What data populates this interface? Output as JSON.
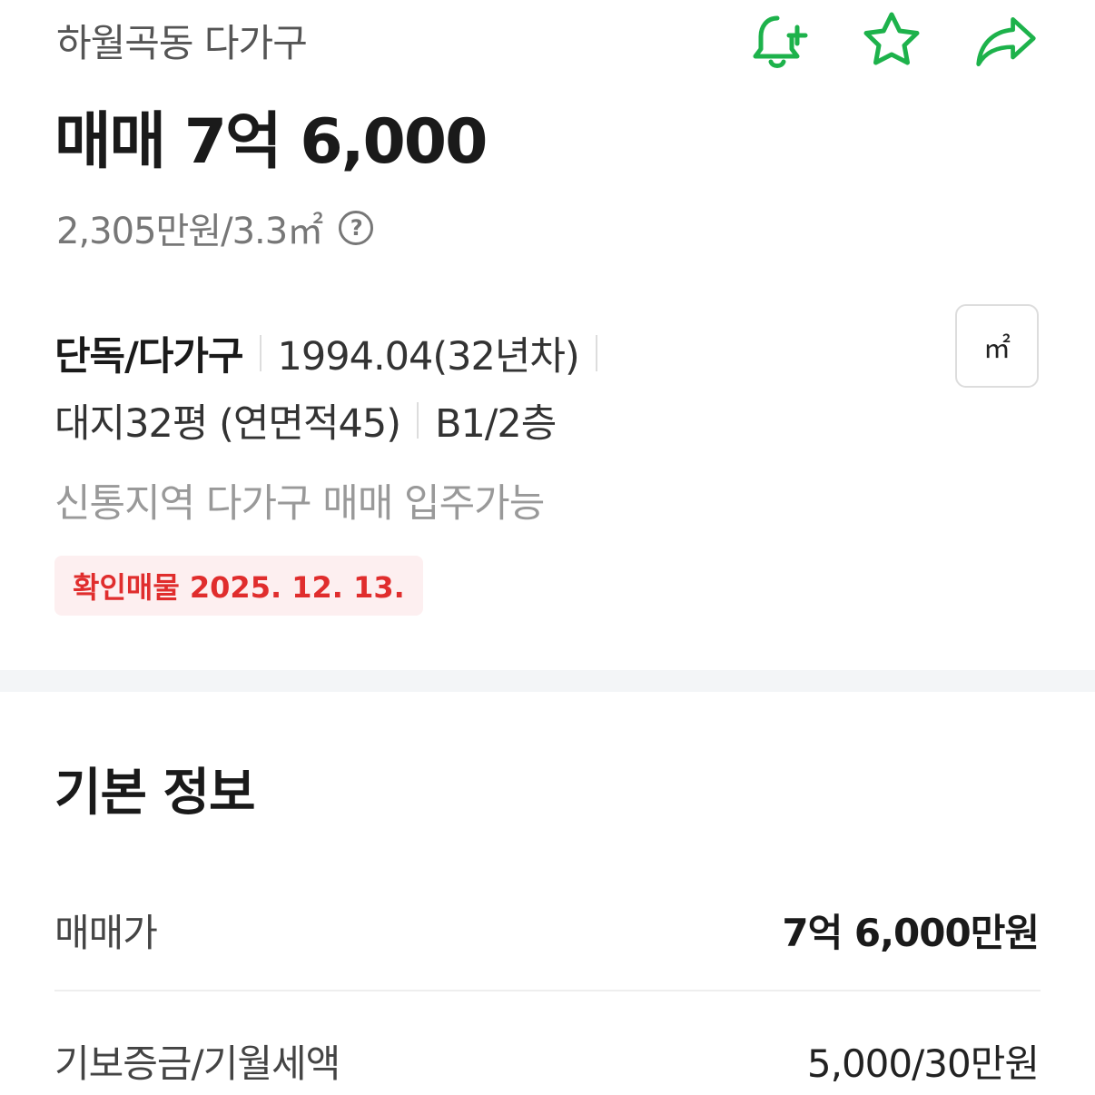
{
  "header": {
    "location": "하월곡동 다가구",
    "price": "매매 7억 6,000",
    "unit_price": "2,305만원/3.3㎡",
    "help_icon_glyph": "?"
  },
  "icons": {
    "alert": "bell-plus-icon",
    "favorite": "star-icon",
    "share": "share-arrow-icon",
    "accent_color": "#1db24b"
  },
  "summary": {
    "type": "단독/다가구",
    "built": "1994.04(32년차)",
    "land": "대지32평 (연면적45)",
    "floors": "B1/2층",
    "description": "신통지역 다가구 매매 입주가능",
    "badge": "확인매물 2025. 12. 13.",
    "unit_toggle": "㎡"
  },
  "basic_info": {
    "title": "기본 정보",
    "rows": [
      {
        "label": "매매가",
        "value": "7억 6,000만원"
      },
      {
        "label": "기보증금/기월세액",
        "value": "5,000/30만원"
      }
    ]
  }
}
